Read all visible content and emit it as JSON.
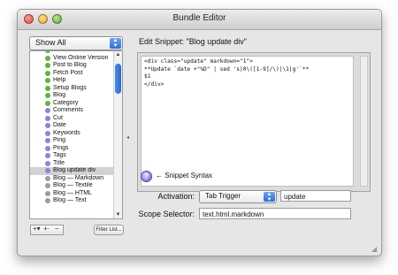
{
  "window": {
    "title": "Bundle Editor"
  },
  "filter_popup": {
    "selected": "Show All"
  },
  "list": {
    "items": [
      {
        "label": "Preview",
        "icon": "green-circle-icon",
        "color": "#5db63a",
        "selected": false
      },
      {
        "label": "View Online Version",
        "icon": "green-circle-icon",
        "color": "#5db63a",
        "selected": false
      },
      {
        "label": "Post to Blog",
        "icon": "green-circle-icon",
        "color": "#5db63a",
        "selected": false
      },
      {
        "label": "Fetch Post",
        "icon": "green-circle-icon",
        "color": "#5db63a",
        "selected": false
      },
      {
        "label": "Help",
        "icon": "green-circle-icon",
        "color": "#5db63a",
        "selected": false
      },
      {
        "label": "Setup Blogs",
        "icon": "green-circle-icon",
        "color": "#5db63a",
        "selected": false
      },
      {
        "label": "Blog",
        "icon": "green-circle-icon",
        "color": "#5db63a",
        "selected": false
      },
      {
        "label": "Category",
        "icon": "green-circle-icon",
        "color": "#5db63a",
        "selected": false
      },
      {
        "label": "Comments",
        "icon": "purple-circle-icon",
        "color": "#9a7be0",
        "selected": false
      },
      {
        "label": "Cut",
        "icon": "purple-circle-icon",
        "color": "#9a7be0",
        "selected": false
      },
      {
        "label": "Date",
        "icon": "purple-circle-icon",
        "color": "#9a7be0",
        "selected": false
      },
      {
        "label": "Keywords",
        "icon": "purple-circle-icon",
        "color": "#9a7be0",
        "selected": false
      },
      {
        "label": "Ping",
        "icon": "purple-circle-icon",
        "color": "#9a7be0",
        "selected": false
      },
      {
        "label": "Pings",
        "icon": "purple-circle-icon",
        "color": "#9a7be0",
        "selected": false
      },
      {
        "label": "Tags",
        "icon": "purple-circle-icon",
        "color": "#9a7be0",
        "selected": false
      },
      {
        "label": "Title",
        "icon": "purple-circle-icon",
        "color": "#9a7be0",
        "selected": false
      },
      {
        "label": "Blog update div",
        "icon": "purple-circle-icon",
        "color": "#9a7be0",
        "selected": true
      },
      {
        "label": "Blog — Markdown",
        "icon": "gray-circle-icon",
        "color": "#9c9c9c",
        "selected": false
      },
      {
        "label": "Blog — Textile",
        "icon": "gray-circle-icon",
        "color": "#9c9c9c",
        "selected": false
      },
      {
        "label": "Blog — HTML",
        "icon": "gray-circle-icon",
        "color": "#9c9c9c",
        "selected": false
      },
      {
        "label": "Blog — Text",
        "icon": "gray-circle-icon",
        "color": "#9c9c9c",
        "selected": false
      }
    ]
  },
  "bottom_buttons": {
    "add": "+▾",
    "add_special": "+·",
    "remove": "−",
    "filter": "Filter List..."
  },
  "editor": {
    "heading": "Edit Snippet: \"Blog update div\"",
    "lines": [
      "<div class=\"update\" markdown=\"1\">",
      "**Update `date +\"%D\" | sed 's|0\\([1-9]/\\)|\\1|g'`**",
      "$1",
      "</div>"
    ]
  },
  "help": {
    "text": "← Snippet Syntax",
    "icon_glyph": "?"
  },
  "activation": {
    "label": "Activation:",
    "type": "Tab Trigger",
    "value": "update"
  },
  "scope": {
    "label": "Scope Selector:",
    "value": "text.html.markdown"
  }
}
